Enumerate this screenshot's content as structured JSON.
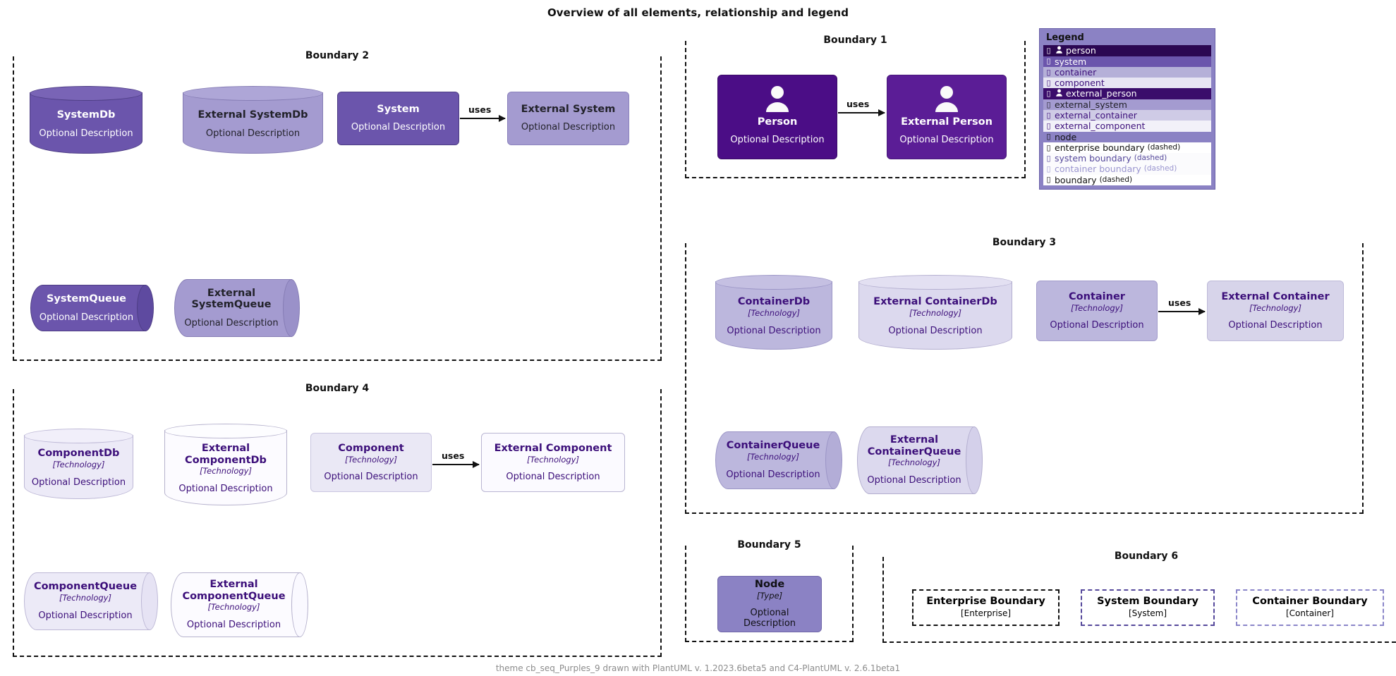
{
  "title": "Overview of all elements, relationship and legend",
  "footer": "theme cb_seq_Purples_9 drawn with PlantUML v. 1.2023.6beta5 and C4-PlantUML v. 2.6.1beta1",
  "labels": {
    "optional_description": "Optional Description",
    "technology": "[Technology]",
    "type": "[Type]",
    "uses": "uses"
  },
  "boundaries": {
    "b1": {
      "title": "Boundary 1"
    },
    "b2": {
      "title": "Boundary 2"
    },
    "b3": {
      "title": "Boundary 3"
    },
    "b4": {
      "title": "Boundary 4"
    },
    "b5": {
      "title": "Boundary 5"
    },
    "b6": {
      "title": "Boundary 6"
    }
  },
  "elements": {
    "person": {
      "name": "Person",
      "desc": "Optional Description"
    },
    "external_person": {
      "name": "External Person",
      "desc": "Optional Description"
    },
    "system_db": {
      "name": "SystemDb",
      "desc": "Optional Description"
    },
    "external_system_db": {
      "name": "External SystemDb",
      "desc": "Optional Description"
    },
    "system": {
      "name": "System",
      "desc": "Optional Description"
    },
    "external_system": {
      "name": "External System",
      "desc": "Optional Description"
    },
    "system_queue": {
      "name": "SystemQueue",
      "desc": "Optional Description"
    },
    "external_system_queue": {
      "name": "External SystemQueue",
      "desc": "Optional Description"
    },
    "container_db": {
      "name": "ContainerDb",
      "tech": "[Technology]",
      "desc": "Optional Description"
    },
    "external_container_db": {
      "name": "External ContainerDb",
      "tech": "[Technology]",
      "desc": "Optional Description"
    },
    "container": {
      "name": "Container",
      "tech": "[Technology]",
      "desc": "Optional Description"
    },
    "external_container": {
      "name": "External Container",
      "tech": "[Technology]",
      "desc": "Optional Description"
    },
    "container_queue": {
      "name": "ContainerQueue",
      "tech": "[Technology]",
      "desc": "Optional Description"
    },
    "external_container_queue": {
      "name": "External ContainerQueue",
      "tech": "[Technology]",
      "desc": "Optional Description"
    },
    "component_db": {
      "name": "ComponentDb",
      "tech": "[Technology]",
      "desc": "Optional Description"
    },
    "external_component_db": {
      "name": "External ComponentDb",
      "tech": "[Technology]",
      "desc": "Optional Description"
    },
    "component": {
      "name": "Component",
      "tech": "[Technology]",
      "desc": "Optional Description"
    },
    "external_component": {
      "name": "External Component",
      "tech": "[Technology]",
      "desc": "Optional Description"
    },
    "component_queue": {
      "name": "ComponentQueue",
      "tech": "[Technology]",
      "desc": "Optional Description"
    },
    "external_component_queue": {
      "name": "External ComponentQueue",
      "tech": "[Technology]",
      "desc": "Optional Description"
    },
    "node": {
      "name": "Node",
      "tech": "[Type]",
      "desc": "Optional Description"
    },
    "enterprise_boundary": {
      "name": "Enterprise Boundary",
      "tech": "[Enterprise]"
    },
    "system_boundary": {
      "name": "System Boundary",
      "tech": "[System]"
    },
    "container_boundary": {
      "name": "Container Boundary",
      "tech": "[Container]"
    }
  },
  "relationships": [
    {
      "from": "person",
      "to": "external_person",
      "label": "uses"
    },
    {
      "from": "system",
      "to": "external_system",
      "label": "uses"
    },
    {
      "from": "container",
      "to": "external_container",
      "label": "uses"
    },
    {
      "from": "component",
      "to": "external_component",
      "label": "uses"
    }
  ],
  "legend": {
    "title": "Legend",
    "rows": [
      {
        "label": "person",
        "suffix": "",
        "person_icon": true,
        "color": "#2b0752"
      },
      {
        "label": "system",
        "suffix": "",
        "person_icon": false,
        "color": "#6b55ac"
      },
      {
        "label": "container",
        "suffix": "",
        "person_icon": false,
        "color": "#b5b0d8"
      },
      {
        "label": "component",
        "suffix": "",
        "person_icon": false,
        "color": "#e7e5f3"
      },
      {
        "label": "external_person",
        "suffix": "",
        "person_icon": true,
        "color": "#3a0d6b"
      },
      {
        "label": "external_system",
        "suffix": "",
        "person_icon": false,
        "color": "#a49bd0"
      },
      {
        "label": "external_container",
        "suffix": "",
        "person_icon": false,
        "color": "#cfcbe6"
      },
      {
        "label": "external_component",
        "suffix": "",
        "person_icon": false,
        "color": "#f2f1f9"
      },
      {
        "label": "node",
        "suffix": "",
        "person_icon": false,
        "color": "#8b82c4"
      },
      {
        "label": "enterprise boundary",
        "suffix": "(dashed)",
        "person_icon": false,
        "color": "#ffffff"
      },
      {
        "label": "system boundary",
        "suffix": "(dashed)",
        "person_icon": false,
        "color": "#fbfbfd"
      },
      {
        "label": "container boundary",
        "suffix": "(dashed)",
        "person_icon": false,
        "color": "#fbfbfd"
      },
      {
        "label": "boundary",
        "suffix": "(dashed)",
        "person_icon": false,
        "color": "#ffffff"
      }
    ]
  },
  "colors": {
    "person": "#4b0d86",
    "external_person": "#5b1d96",
    "system": "#6b55ac",
    "external_system": "#a49bd0",
    "container": "#bcb7dd",
    "external_container": "#d7d4ea",
    "component": "#eae8f5",
    "external_component": "#fbfaff",
    "node": "#8b82c4",
    "legend_background": "#8b82c4",
    "boundary_enterprise": "#111111",
    "boundary_system": "#55489b",
    "boundary_container": "#8b86c9"
  }
}
